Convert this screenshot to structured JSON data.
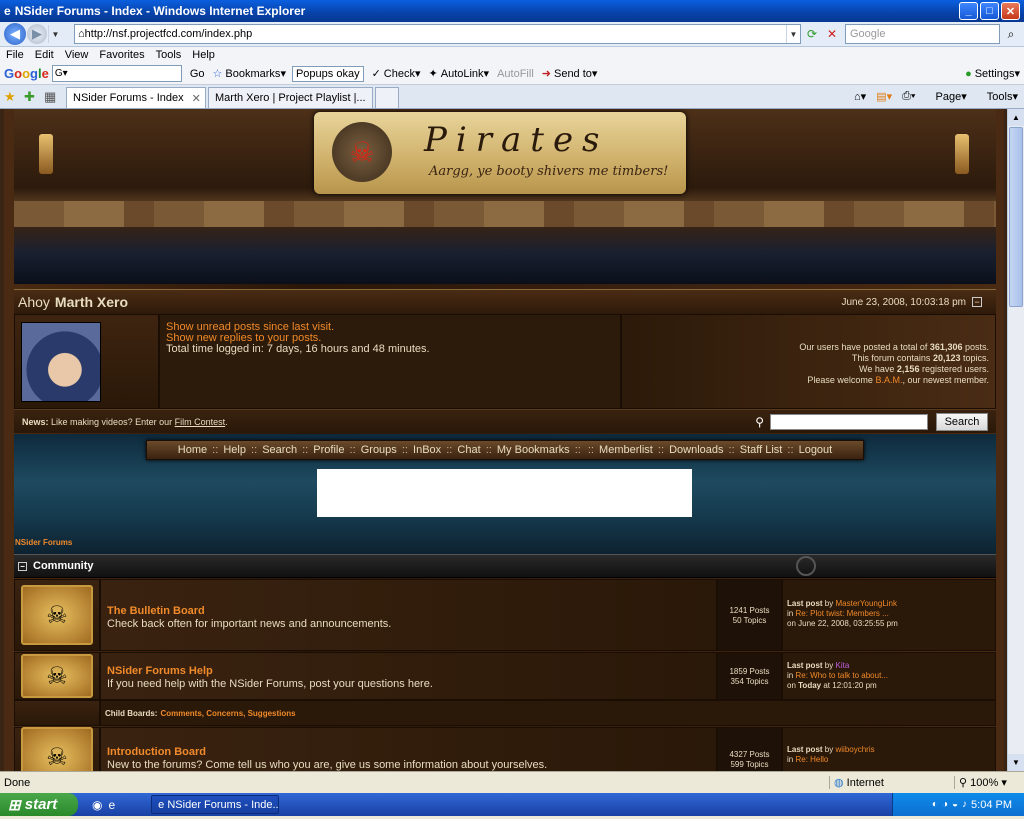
{
  "window": {
    "title": "NSider Forums - Index - Windows Internet Explorer"
  },
  "address": {
    "url": "http://nsf.projectfcd.com/index.php",
    "search_placeholder": "Google"
  },
  "menu": [
    "File",
    "Edit",
    "View",
    "Favorites",
    "Tools",
    "Help"
  ],
  "google_toolbar": {
    "go": "Go",
    "bookmarks": "Bookmarks",
    "popups": "Popups okay",
    "check": "Check",
    "autolink": "AutoLink",
    "autofill": "AutoFill",
    "sendto": "Send to",
    "settings": "Settings"
  },
  "tabs": [
    {
      "label": "NSider Forums - Index"
    },
    {
      "label": "Marth Xero | Project Playlist |..."
    }
  ],
  "command_bar": {
    "page": "Page",
    "tools": "Tools"
  },
  "banner": {
    "name": "Pirates",
    "tagline": "Aargg, ye booty shivers me timbers!"
  },
  "user": {
    "greeting": "Ahoy",
    "name": "Marth Xero",
    "datetime": "June 23, 2008, 10:03:18 pm",
    "link_unread": "Show unread posts since last visit.",
    "link_replies": "Show new replies to your posts.",
    "time_logged": "Total time logged in: 7 days, 16 hours and 48 minutes."
  },
  "stats": {
    "line1_pre": "Our users have posted a total of",
    "posts": "361,306",
    "line1_post": "posts.",
    "line2_pre": "This forum contains",
    "topics": "20,123",
    "line2_post": "topics.",
    "line3_pre": "We have",
    "users": "2,156",
    "line3_post": "registered users.",
    "line4_pre": "Please welcome",
    "newest": "B.A.M.",
    "line4_post": ", our newest member."
  },
  "news": {
    "label": "News:",
    "text": "Like making videos? Enter our",
    "link": "Film Contest",
    "end": "."
  },
  "search": {
    "button": "Search"
  },
  "nav": [
    "Home",
    "Help",
    "Search",
    "Profile",
    "Groups",
    "InBox",
    "Chat",
    "My Bookmarks",
    "",
    "Memberlist",
    "Downloads",
    "Staff List",
    "Logout"
  ],
  "breadcrumb": "NSider Forums",
  "category": {
    "name": "Community"
  },
  "boards": [
    {
      "title": "The Bulletin Board",
      "desc": "Check back often for important news and announcements.",
      "posts": "1241 Posts",
      "topics": "50 Topics",
      "last_label": "Last post",
      "by": "by",
      "author": "MasterYoungLink",
      "in": "in",
      "topic": "Re: Plot twist: Members ...",
      "on": "on June 22, 2008, 03:25:55 pm"
    },
    {
      "title": "NSider Forums Help",
      "desc": "If you need help with the NSider Forums, post your questions here.",
      "posts": "1859 Posts",
      "topics": "354 Topics",
      "last_label": "Last post",
      "by": "by",
      "author": "Kita",
      "in": "in",
      "topic": "Re: Who to talk to about...",
      "on_pre": "on",
      "on_bold": "Today",
      "on_post": "at 12:01:20 pm"
    },
    {
      "title": "Introduction Board",
      "desc": "New to the forums? Come tell us who you are, give us some information about yourselves.",
      "posts": "4327 Posts",
      "topics": "599 Topics",
      "last_label": "Last post",
      "by": "by",
      "author": "wiiboychris",
      "in": "in",
      "topic": "Re: Hello"
    }
  ],
  "child_boards": {
    "label": "Child Boards:",
    "list": "Comments, Concerns, Suggestions"
  },
  "status": {
    "left": "Done",
    "zone": "Internet",
    "zoom": "100%"
  },
  "taskbar": {
    "start": "start",
    "item": "NSider Forums - Inde...",
    "clock": "5:04 PM"
  }
}
